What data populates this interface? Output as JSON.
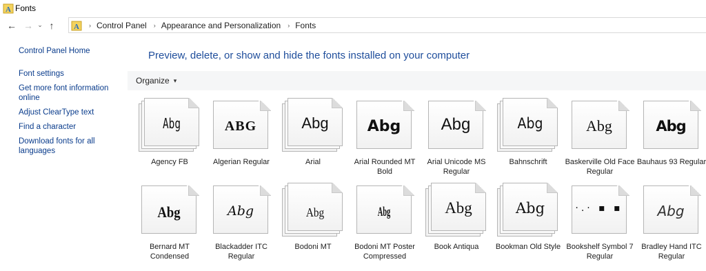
{
  "window": {
    "title": "Fonts"
  },
  "nav": {
    "back_icon": "←",
    "forward_icon": "→",
    "recent_icon": "⌄",
    "up_icon": "↑",
    "chevron_icon": "›"
  },
  "breadcrumb": [
    "Control Panel",
    "Appearance and Personalization",
    "Fonts"
  ],
  "sidebar": {
    "home": "Control Panel Home",
    "links": [
      "Font settings",
      "Get more font information online",
      "Adjust ClearType text",
      "Find a character",
      "Download fonts for all languages"
    ]
  },
  "header": "Preview, delete, or show and hide the fonts installed on your computer",
  "toolbar": {
    "organize": "Organize",
    "caret_icon": "▾"
  },
  "fonts": [
    {
      "name": "Agency FB",
      "sample": "Abg",
      "family": "single-stacked"
    },
    {
      "name": "Algerian Regular",
      "sample": "ABG",
      "family": "single"
    },
    {
      "name": "Arial",
      "sample": "Abg",
      "family": "stacked"
    },
    {
      "name": "Arial Rounded MT Bold",
      "sample": "Abg",
      "family": "single"
    },
    {
      "name": "Arial Unicode MS Regular",
      "sample": "Abg",
      "family": "single"
    },
    {
      "name": "Bahnschrift",
      "sample": "Abg",
      "family": "stacked"
    },
    {
      "name": "Baskerville Old Face Regular",
      "sample": "Abg",
      "family": "single"
    },
    {
      "name": "Bauhaus 93 Regular",
      "sample": "Abg",
      "family": "single"
    },
    {
      "name": "Bernard MT Condensed",
      "sample": "Abg",
      "family": "single"
    },
    {
      "name": "Blackadder ITC Regular",
      "sample": "Abg",
      "family": "single"
    },
    {
      "name": "Bodoni MT",
      "sample": "Abg",
      "family": "stacked"
    },
    {
      "name": "Bodoni MT Poster Compressed",
      "sample": "Abg",
      "family": "single"
    },
    {
      "name": "Book Antiqua",
      "sample": "Abg",
      "family": "stacked"
    },
    {
      "name": "Bookman Old Style",
      "sample": "Abg",
      "family": "stacked"
    },
    {
      "name": "Bookshelf Symbol 7 Regular",
      "sample": "·.· ▪ ▪",
      "family": "single"
    },
    {
      "name": "Bradley Hand ITC Regular",
      "sample": "Abg",
      "family": "single"
    }
  ]
}
